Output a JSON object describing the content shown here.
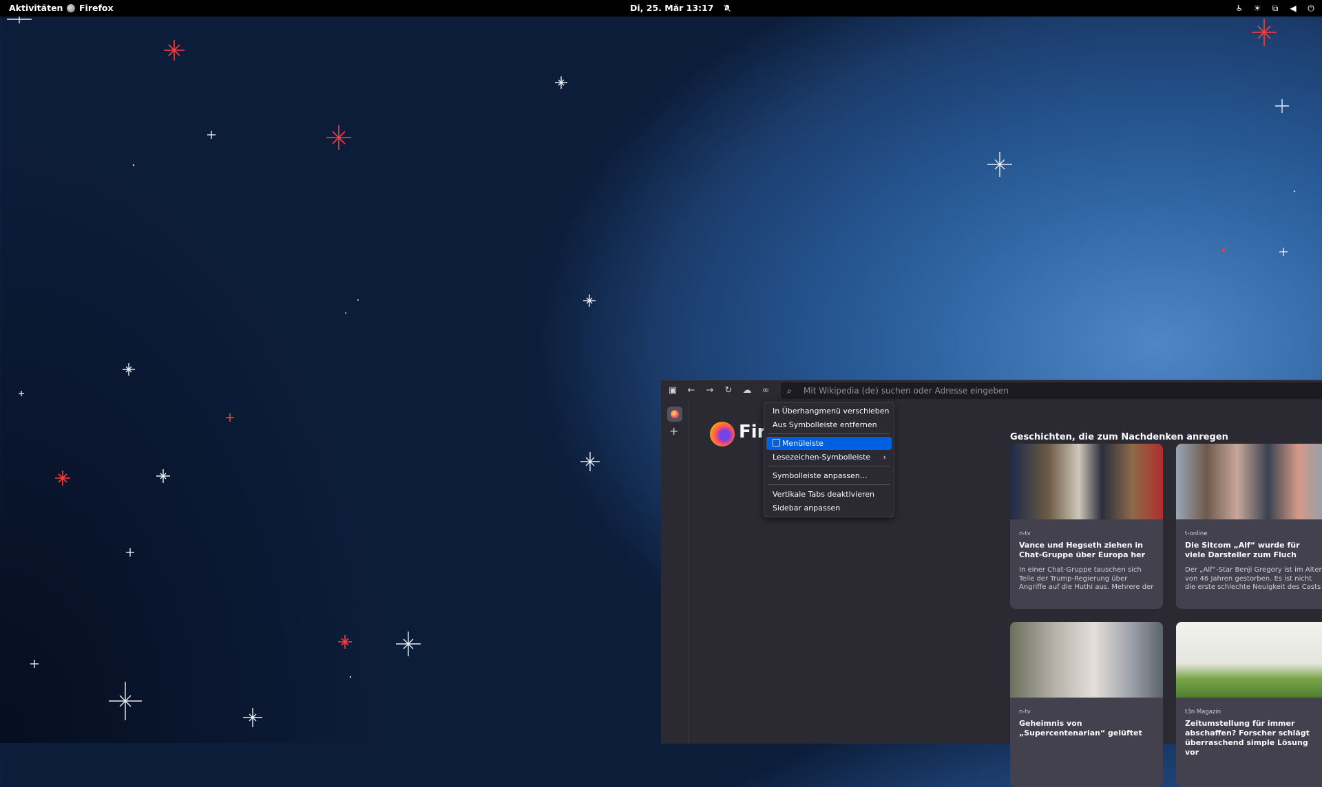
{
  "topbar": {
    "activities": "Aktivitäten",
    "app_name": "Firefox",
    "app_icon": "firefox-icon",
    "clock": "Di, 25. Mär  13:17",
    "notification_icon": "bell-off-icon",
    "tray_icons": [
      "accessibility-icon",
      "brightness-icon",
      "network-icon",
      "volume-icon",
      "power-icon"
    ]
  },
  "firefox": {
    "toolbar_icons": [
      "sidebar-toggle-icon",
      "back-icon",
      "forward-icon",
      "reload-icon",
      "account-icon",
      "extension-icon"
    ],
    "url_placeholder": "Mit Wikipedia (de) suchen oder Adresse eingeben",
    "brand_partial": "Fir",
    "stories_title": "Geschichten, die zum Nachdenken anregen",
    "cards": [
      {
        "source": "n-tv",
        "title": "Vance und Hegseth ziehen in Chat-Gruppe über Europa her",
        "excerpt": "In einer Chat-Gruppe tauschen sich Teile der Trump-Regierung über Angriffe auf die Huthi aus. Mehrere der Beteiligten..."
      },
      {
        "source": "t-online",
        "title": "Die Sitcom „Alf“ wurde für viele Darsteller zum Fluch",
        "excerpt": "Der „Alf“-Star Benji Gregory ist im Alter von 46 Jahren gestorben. Es ist nicht die erste schlechte Neuigkeit des Casts der..."
      },
      {
        "source": "n-tv",
        "title": "Geheimnis von „Supercentenarian“ gelüftet",
        "excerpt": ""
      },
      {
        "source": "t3n Magazin",
        "title": "Zeitumstellung für immer abschaffen? Forscher schlägt überraschend simple Lösung vor",
        "excerpt": ""
      }
    ]
  },
  "context_menu": {
    "items": [
      "In Überhangmenü verschieben",
      "Aus Symbolleiste entfernen",
      "Menüleiste",
      "Lesezeichen-Symbolleiste",
      "Symbolleiste anpassen…",
      "Vertikale Tabs deaktivieren",
      "Sidebar anpassen"
    ],
    "selected": "Menüleiste"
  }
}
